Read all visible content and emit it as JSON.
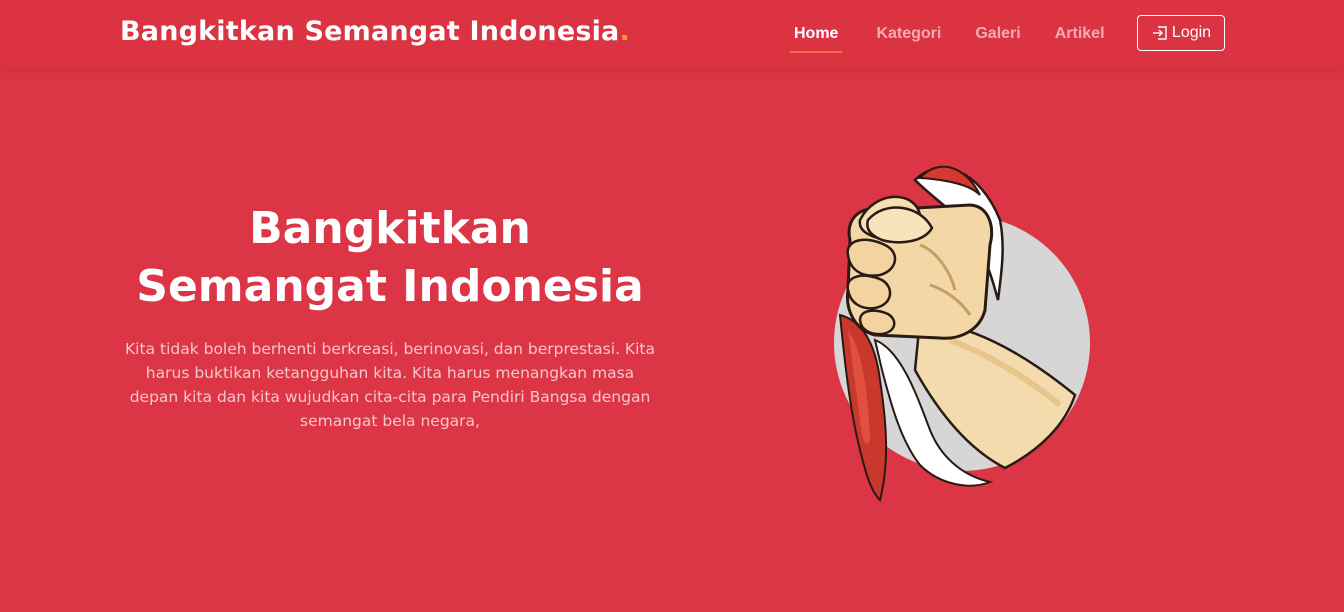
{
  "header": {
    "brand": "Bangkitkan Semangat Indonesia",
    "brand_dot": ".",
    "nav": [
      {
        "label": "Home",
        "active": true
      },
      {
        "label": "Kategori",
        "active": false
      },
      {
        "label": "Galeri",
        "active": false
      },
      {
        "label": "Artikel",
        "active": false
      }
    ],
    "login_label": "Login"
  },
  "hero": {
    "title_line1": "Bangkitkan",
    "title_line2": "Semangat Indonesia",
    "text": "Kita tidak boleh berhenti berkreasi, berinovasi, dan berprestasi. Kita harus buktikan ketangguhan kita. Kita harus menangkan masa depan kita dan kita wujudkan cita-cita para Pendiri Bangsa dengan semangat bela negara,"
  },
  "colors": {
    "primary": "#dc3545",
    "accent": "#f59c3a",
    "active_underline": "#f46f4a"
  },
  "icons": {
    "login": "login-icon",
    "illustration": "fist-holding-flag-illustration"
  }
}
